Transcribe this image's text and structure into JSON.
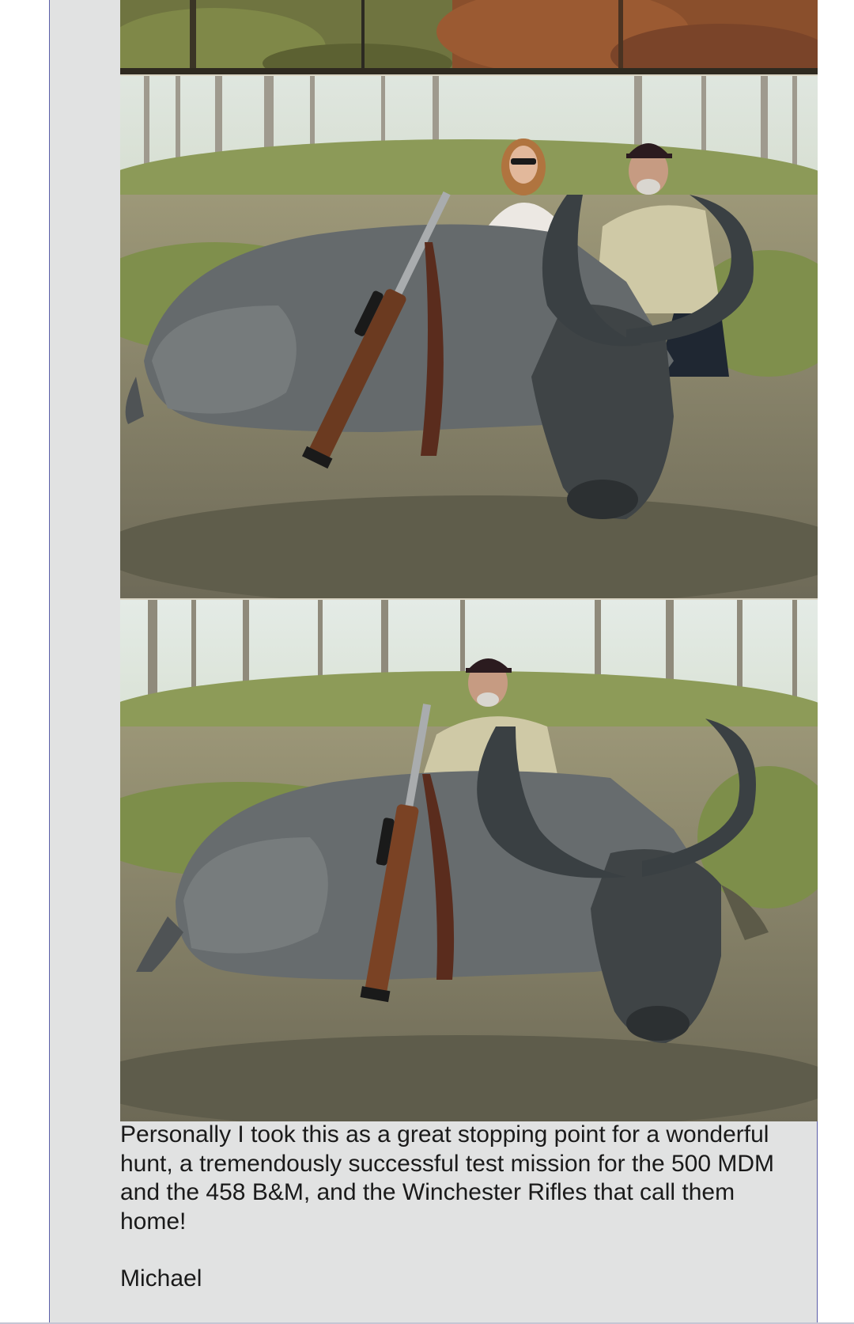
{
  "post": {
    "photos": [
      {
        "name": "photo-top-crop",
        "subject": "brush and tree trunks"
      },
      {
        "name": "photo-buffalo-two-hunters",
        "subject": "water buffalo with rifle, woman and man"
      },
      {
        "name": "photo-buffalo-one-hunter",
        "subject": "water buffalo with rifle and man"
      }
    ],
    "text": "Personally I took this as a great stopping point for a wonderful hunt, a tremendously successful test mission for the 500 MDM and the 458 B&M, and the Winchester Rifles that call them home!",
    "signature": "Michael"
  },
  "colors": {
    "panel": "#e1e2e2",
    "border": "#5b5ea8",
    "text": "#1a1a1a"
  }
}
